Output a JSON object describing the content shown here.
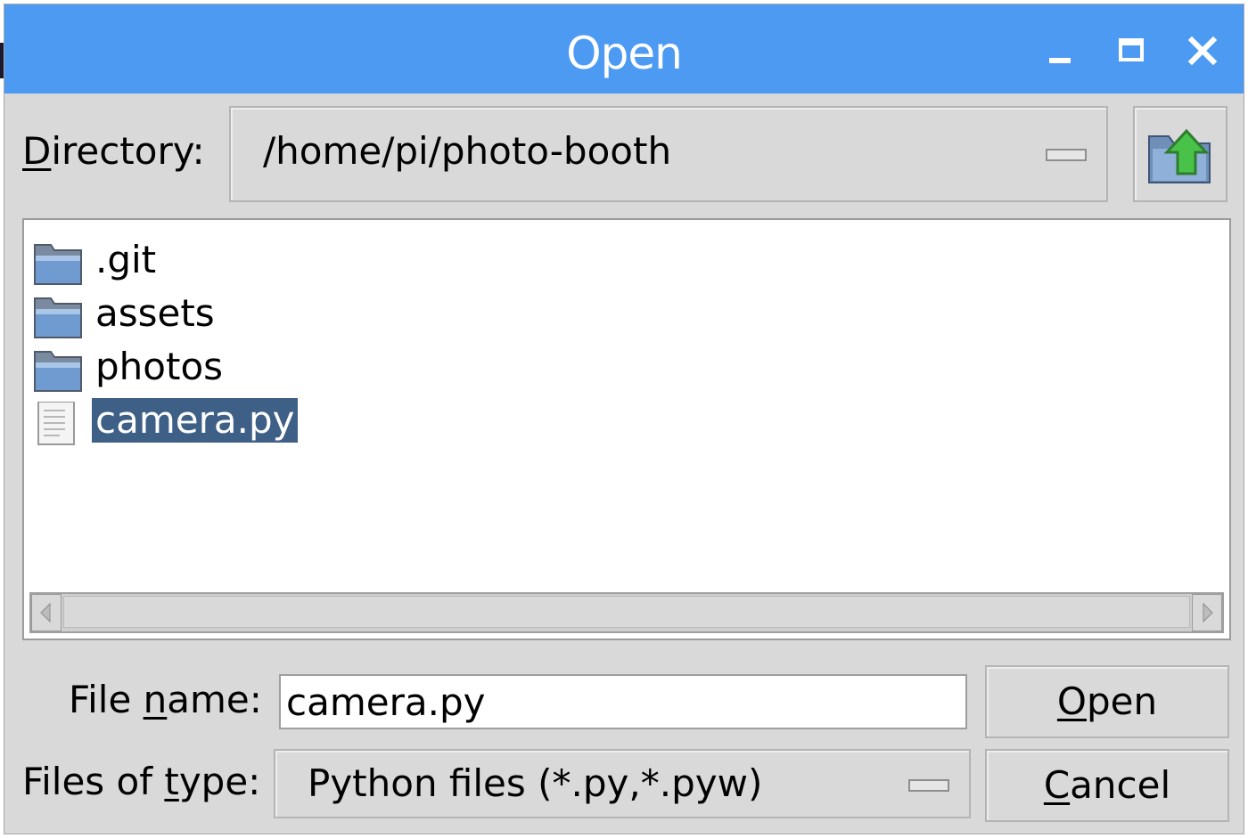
{
  "window": {
    "title": "Open",
    "titlebar_color": "#4d9af2",
    "controls": [
      "minimize-icon",
      "maximize-icon",
      "close-icon"
    ]
  },
  "directory": {
    "label_underlined": "D",
    "label_rest": "irectory:",
    "value": "/home/pi/photo-booth",
    "up_button_icon": "folder-up-icon"
  },
  "file_list": {
    "items": [
      {
        "name": ".git",
        "type": "folder",
        "icon": "folder-icon",
        "selected": false
      },
      {
        "name": "assets",
        "type": "folder",
        "icon": "folder-icon",
        "selected": false
      },
      {
        "name": "photos",
        "type": "folder",
        "icon": "folder-icon",
        "selected": false
      },
      {
        "name": "camera.py",
        "type": "file",
        "icon": "file-icon",
        "selected": true
      }
    ],
    "selection_color": "#3e5f86"
  },
  "file_name": {
    "label_pre": "File ",
    "label_underlined": "n",
    "label_post": "ame:",
    "value": "camera.py"
  },
  "file_type": {
    "label_pre": "Files of ",
    "label_underlined": "t",
    "label_post": "ype:",
    "value": "Python files (*.py,*.pyw)"
  },
  "buttons": {
    "open_underlined": "O",
    "open_rest": "pen",
    "cancel_underlined": "C",
    "cancel_rest": "ancel"
  }
}
